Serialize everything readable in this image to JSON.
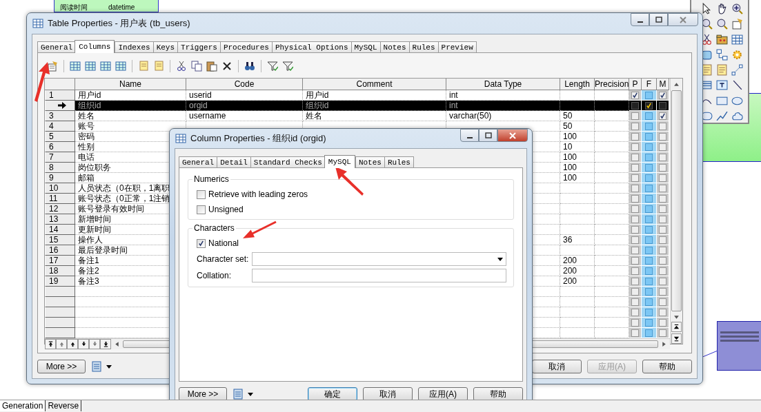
{
  "diagram": {
    "entity_attribute": "阅读时间",
    "entity_type": "datetime"
  },
  "table_properties": {
    "title": "Table Properties - 用户表 (tb_users)",
    "tabs": [
      {
        "label": "General",
        "selected": false
      },
      {
        "label": "Columns",
        "selected": true
      },
      {
        "label": "Indexes",
        "selected": false
      },
      {
        "label": "Keys",
        "selected": false
      },
      {
        "label": "Triggers",
        "selected": false
      },
      {
        "label": "Procedures",
        "selected": false
      },
      {
        "label": "Physical Options",
        "selected": false
      },
      {
        "label": "MySQL",
        "selected": false
      },
      {
        "label": "Notes",
        "selected": false
      },
      {
        "label": "Rules",
        "selected": false
      },
      {
        "label": "Preview",
        "selected": false
      }
    ],
    "columns": [
      "Name",
      "Code",
      "Comment",
      "Data Type",
      "Length",
      "Precision",
      "P",
      "F",
      "M"
    ],
    "rows": [
      {
        "number": "1",
        "name": "用户id",
        "code": "userid",
        "comment": "用户id",
        "data_type": "int",
        "p": true,
        "f": false,
        "m": true,
        "selected": false
      },
      {
        "name": "组织id",
        "code": "orgid",
        "comment": "组织id",
        "data_type": "int",
        "p": false,
        "f": true,
        "m": false,
        "selected": true
      },
      {
        "number": "3",
        "name": "姓名",
        "code": "username",
        "comment": "姓名",
        "data_type": "varchar(50)",
        "length": "50",
        "p": false,
        "f": false,
        "m": true,
        "selected": false
      },
      {
        "number": "4",
        "name": "账号",
        "length": "50",
        "p": false,
        "f": false,
        "m": false,
        "selected": false
      },
      {
        "number": "5",
        "name": "密码",
        "length": "100",
        "p": false,
        "f": false,
        "m": false,
        "selected": false
      },
      {
        "number": "6",
        "name": "性别",
        "length": "10",
        "p": false,
        "f": false,
        "m": false,
        "selected": false
      },
      {
        "number": "7",
        "name": "电话",
        "length": "100",
        "p": false,
        "f": false,
        "m": false,
        "selected": false
      },
      {
        "number": "8",
        "name": "岗位职务",
        "length": "100",
        "p": false,
        "f": false,
        "m": false,
        "selected": false
      },
      {
        "number": "9",
        "name": "邮箱",
        "length": "100",
        "p": false,
        "f": false,
        "m": false,
        "selected": false
      },
      {
        "number": "10",
        "name": "人员状态（0在职，1离职",
        "p": false,
        "f": false,
        "m": false,
        "selected": false
      },
      {
        "number": "11",
        "name": "账号状态（0正常，1注销",
        "p": false,
        "f": false,
        "m": false,
        "selected": false
      },
      {
        "number": "12",
        "name": "账号登录有效时间",
        "p": false,
        "f": false,
        "m": false,
        "selected": false
      },
      {
        "number": "13",
        "name": "新增时间",
        "p": false,
        "f": false,
        "m": false,
        "selected": false
      },
      {
        "number": "14",
        "name": "更新时间",
        "p": false,
        "f": false,
        "m": false,
        "selected": false
      },
      {
        "number": "15",
        "name": "操作人",
        "length": "36",
        "p": false,
        "f": false,
        "m": false,
        "selected": false
      },
      {
        "number": "16",
        "name": "最后登录时间",
        "p": false,
        "f": false,
        "m": false,
        "selected": false
      },
      {
        "number": "17",
        "name": "备注1",
        "length": "200",
        "p": false,
        "f": false,
        "m": false,
        "selected": false
      },
      {
        "number": "18",
        "name": "备注2",
        "length": "200",
        "p": false,
        "f": false,
        "m": false,
        "selected": false
      },
      {
        "number": "19",
        "name": "备注3",
        "length": "200",
        "p": false,
        "f": false,
        "m": false,
        "selected": false
      },
      {
        "p": false,
        "f": false,
        "m": false,
        "selected": false
      },
      {
        "p": false,
        "f": false,
        "m": false,
        "selected": false
      },
      {
        "p": false,
        "f": false,
        "m": false,
        "selected": false
      },
      {
        "p": false,
        "f": false,
        "m": false,
        "selected": false
      },
      {
        "p": false,
        "f": false,
        "m": false,
        "selected": false
      }
    ],
    "more_button": "More >>",
    "buttons": [
      {
        "label": "取消",
        "disabled": false
      },
      {
        "label": "应用(A)",
        "disabled": true
      },
      {
        "label": "帮助",
        "disabled": false
      }
    ]
  },
  "column_properties": {
    "title": "Column Properties - 组织id (orgid)",
    "tabs": [
      {
        "label": "General",
        "selected": false
      },
      {
        "label": "Detail",
        "selected": false
      },
      {
        "label": "Standard Checks",
        "selected": false
      },
      {
        "label": "MySQL",
        "selected": true
      },
      {
        "label": "Notes",
        "selected": false
      },
      {
        "label": "Rules",
        "selected": false
      }
    ],
    "numerics": {
      "title": "Numerics",
      "options": [
        {
          "label": "Retrieve with leading zeros",
          "checked": false
        },
        {
          "label": "Unsigned",
          "checked": false
        }
      ]
    },
    "characters": {
      "title": "Characters",
      "national": {
        "label": "National",
        "checked": true
      },
      "character_set_label": "Character set:",
      "collation_label": "Collation:"
    },
    "more_button": "More >>",
    "buttons": [
      {
        "label": "确定",
        "default": true
      },
      {
        "label": "取消",
        "default": false
      },
      {
        "label": "应用(A)",
        "default": false
      },
      {
        "label": "帮助",
        "default": false
      }
    ]
  },
  "bottom_tabs": [
    {
      "label": "Generation",
      "selected": true
    },
    {
      "label": "Reverse",
      "selected": false
    }
  ]
}
